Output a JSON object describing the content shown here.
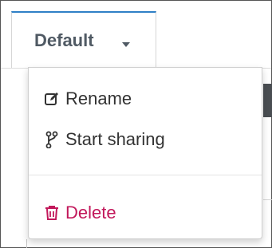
{
  "tab": {
    "label": "Default"
  },
  "menu": {
    "items": [
      {
        "label": "Rename",
        "icon": "edit-icon"
      },
      {
        "label": "Start sharing",
        "icon": "branch-icon"
      },
      {
        "label": "Delete",
        "icon": "trash-icon",
        "color": "#c2185b"
      }
    ]
  },
  "colors": {
    "accent": "#2f80c6",
    "danger": "#c2185b",
    "text": "#333333"
  }
}
